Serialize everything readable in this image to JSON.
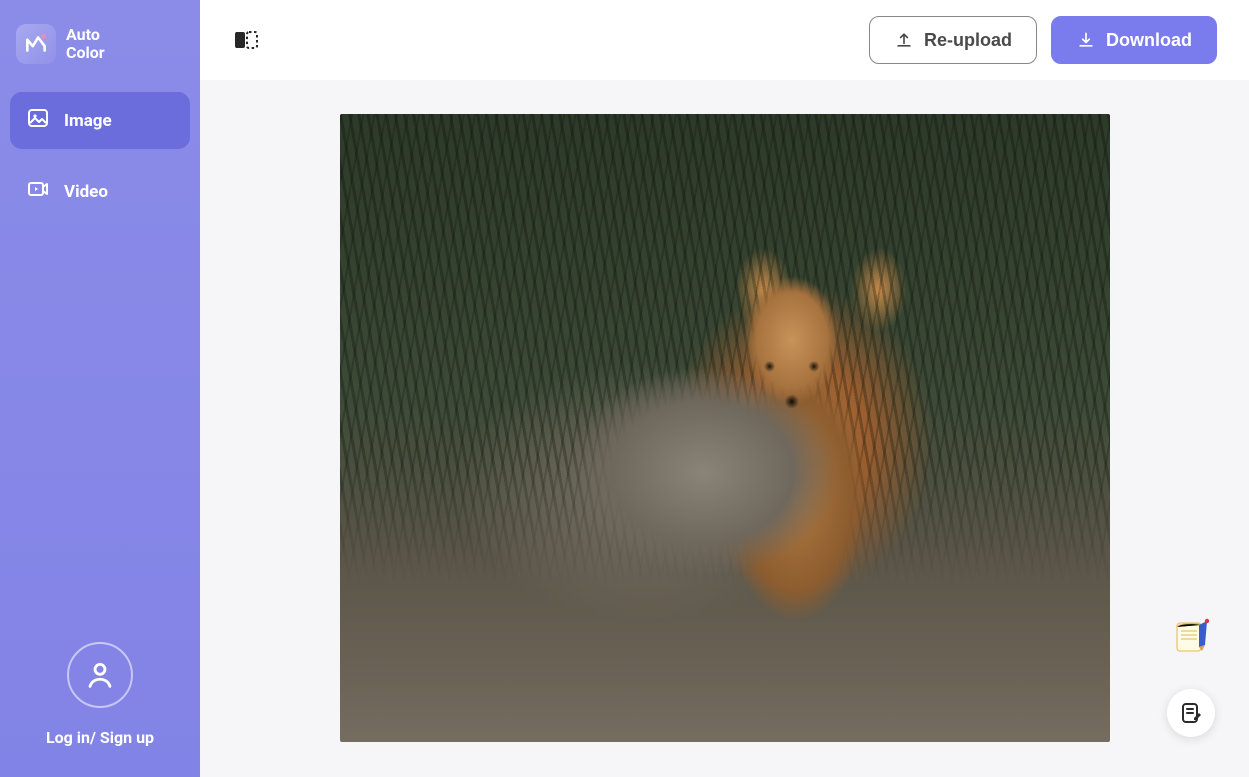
{
  "brand": {
    "line1": "Auto",
    "line2": "Color"
  },
  "sidebar": {
    "items": [
      {
        "label": "Image",
        "icon": "picture-icon",
        "active": true
      },
      {
        "label": "Video",
        "icon": "video-icon",
        "active": false
      }
    ]
  },
  "account": {
    "login_label": "Log in/ Sign up"
  },
  "topbar": {
    "reupload_label": "Re-upload",
    "download_label": "Download"
  },
  "preview": {
    "subject": "fox standing in grass",
    "description": "A fox with orange and grey fur standing on rocky ground with tall green grass behind it."
  },
  "colors": {
    "sidebar_bg": "#8485e7",
    "sidebar_active": "#6b6ddc",
    "primary": "#7a7cee",
    "canvas_bg": "#f6f6f8"
  }
}
